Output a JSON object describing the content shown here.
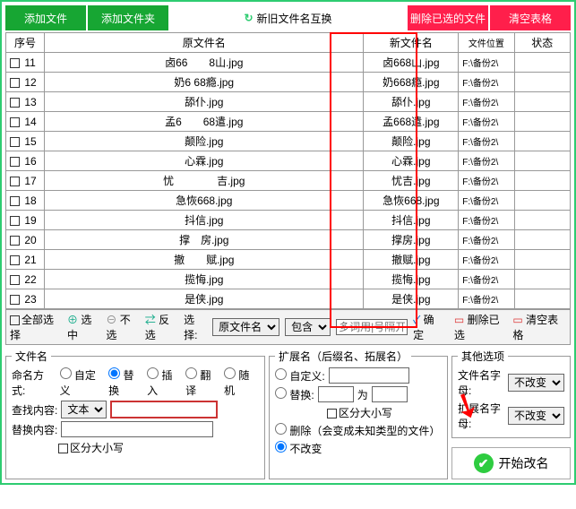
{
  "topButtons": {
    "addFile": "添加文件",
    "addFolder": "添加文件夹",
    "swap": "新旧文件名互换",
    "delSelected": "删除已选的文件",
    "clearTable": "清空表格"
  },
  "columns": {
    "seq": "序号",
    "old": "原文件名",
    "new": "新文件名",
    "path": "文件位置",
    "status": "状态"
  },
  "rows": [
    {
      "i": "11",
      "old": "卤66　　8山.jpg",
      "new": "卤668山.jpg",
      "p": "F:\\备份2\\"
    },
    {
      "i": "12",
      "old": "奶6 68瘾.jpg",
      "new": "奶668瘾.jpg",
      "p": "F:\\备份2\\"
    },
    {
      "i": "13",
      "old": "舔仆.jpg",
      "new": "舔仆.jpg",
      "p": "F:\\备份2\\"
    },
    {
      "i": "14",
      "old": "孟6　　68遣.jpg",
      "new": "孟668遣.jpg",
      "p": "F:\\备份2\\"
    },
    {
      "i": "15",
      "old": "颠险.jpg",
      "new": "颠险.jpg",
      "p": "F:\\备份2\\"
    },
    {
      "i": "16",
      "old": "心霖.jpg",
      "new": "心霖.jpg",
      "p": "F:\\备份2\\"
    },
    {
      "i": "17",
      "old": "忧　　　　吉.jpg",
      "new": "忧吉.jpg",
      "p": "F:\\备份2\\"
    },
    {
      "i": "18",
      "old": "急恢668.jpg",
      "new": "急恢668.jpg",
      "p": "F:\\备份2\\"
    },
    {
      "i": "19",
      "old": "抖信.jpg",
      "new": "抖信.jpg",
      "p": "F:\\备份2\\"
    },
    {
      "i": "20",
      "old": "撑　房.jpg",
      "new": "撑房.jpg",
      "p": "F:\\备份2\\"
    },
    {
      "i": "21",
      "old": "撤　　赋.jpg",
      "new": "撤赋.jpg",
      "p": "F:\\备份2\\"
    },
    {
      "i": "22",
      "old": "揽悔.jpg",
      "new": "揽悔.jpg",
      "p": "F:\\备份2\\"
    },
    {
      "i": "23",
      "old": "是侠.jpg",
      "new": "是侠.jpg",
      "p": "F:\\备份2\\"
    }
  ],
  "toolbar": {
    "selectAll": "全部选择",
    "selYes": "选中",
    "selNo": "不选",
    "selInv": "反选",
    "filter": "选择:",
    "filterDD": "原文件名",
    "containDD": "包含",
    "placeholder": "多词用|号隔开",
    "confirm": "确定",
    "delSel": "删除已选",
    "clear": "清空表格"
  },
  "filenamePane": {
    "legend": "文件名",
    "naming": "命名方式:",
    "custom": "自定义",
    "replace": "替换",
    "insert": "插入",
    "translate": "翻译",
    "random": "随机",
    "findLabel": "查找内容:",
    "findMode": "文本",
    "replLabel": "替换内容:",
    "caseSens": "区分大小写"
  },
  "extPane": {
    "legend": "扩展名（后缀名、拓展名）",
    "custom": "自定义:",
    "replace": "替换:",
    "to": "为",
    "caseSens": "区分大小写",
    "delete": "删除（会变成未知类型的文件）",
    "noChange": "不改变"
  },
  "otherPane": {
    "legend": "其他选项",
    "fnameLetter": "文件名字母:",
    "extLetter": "扩展名字母:",
    "noChange": "不改变",
    "start": "开始改名"
  }
}
